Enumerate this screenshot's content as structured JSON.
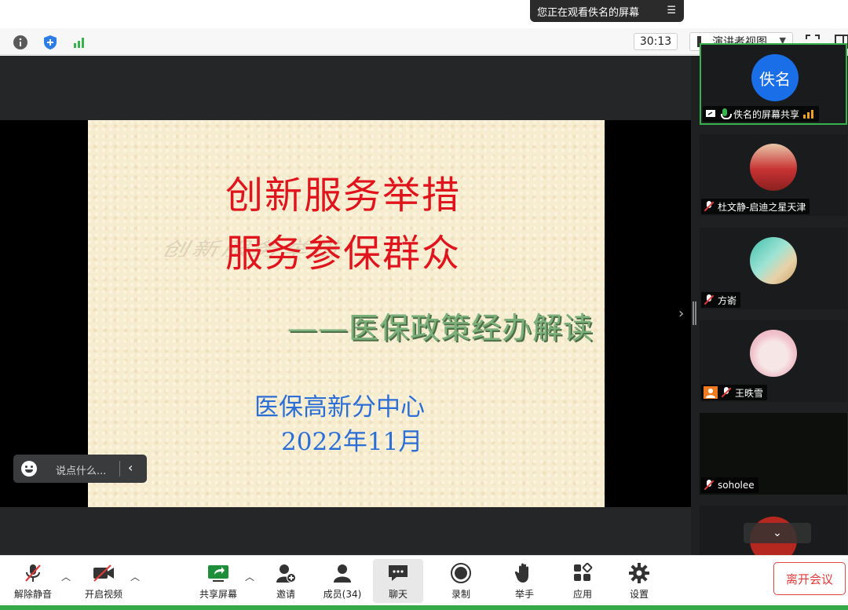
{
  "banner": {
    "text": "您正在观看佚名的屏幕",
    "menu_icon": "list-menu-icon"
  },
  "info_bar": {
    "timer": "30:13",
    "view_mode": "演讲者视图",
    "icons": [
      "info-icon",
      "shield-icon",
      "signal-icon",
      "fullscreen-icon",
      "window-icon"
    ]
  },
  "slide": {
    "line1": "创新服务举措",
    "line2": "服务参保群众",
    "shadow": "创新服务举措",
    "subtitle": "——医保政策经办解读",
    "org": "医保高新分中心",
    "date": "2022年11月",
    "colors": {
      "title": "#e0141c",
      "subtitle": "#7bb07a",
      "org": "#2b6fd6",
      "background": "#f6ecd0"
    }
  },
  "chat_input": {
    "placeholder": "说点什么..."
  },
  "participants": [
    {
      "name": "佚名的屏幕共享",
      "avatar_text": "佚名",
      "mic": "on",
      "active": true
    },
    {
      "name": "杜文静-启迪之星天津",
      "mic": "off"
    },
    {
      "name": "方嵛",
      "mic": "off"
    },
    {
      "name": "王昳雪",
      "mic": "off"
    },
    {
      "name": "soholee",
      "mic": "off"
    }
  ],
  "controls": {
    "unmute": "解除静音",
    "start_video": "开启视频",
    "share_screen": "共享屏幕",
    "invite": "邀请",
    "members": "成员(34)",
    "chat": "聊天",
    "record": "录制",
    "raise_hand": "举手",
    "apps": "应用",
    "settings": "设置",
    "leave": "离开会议"
  }
}
